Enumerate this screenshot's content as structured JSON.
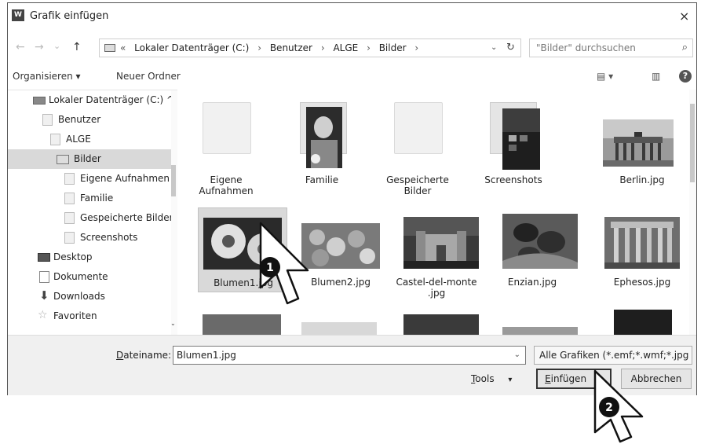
{
  "window": {
    "title": "Grafik einfügen",
    "app_icon": "W",
    "close_glyph": "×"
  },
  "nav": {
    "back_glyph": "←",
    "forward_glyph": "→",
    "recent_glyph": "⌄",
    "up_glyph": "↑",
    "breadcrumb": [
      "«",
      "Lokaler Datenträger (C:)",
      "›",
      "Benutzer",
      "›",
      "ALGE",
      "›",
      "Bilder",
      "›"
    ],
    "dropdown_glyph": "⌄",
    "refresh_glyph": "↻",
    "search_placeholder": "\"Bilder\" durchsuchen",
    "search_glyph": "⌕"
  },
  "toolbar": {
    "organize": "Organisieren ▾",
    "new_folder": "Neuer Ordner",
    "view_glyph": "▤ ▾",
    "pane_glyph": "▥",
    "help_glyph": "?"
  },
  "sidebar": {
    "items": [
      {
        "label": "Lokaler Datenträger (C:)",
        "icon": "drive-icon",
        "expand": "^"
      },
      {
        "label": "Benutzer",
        "icon": "folder-icon"
      },
      {
        "label": "ALGE",
        "icon": "folder-icon"
      },
      {
        "label": "Bilder",
        "icon": "pictures-icon"
      },
      {
        "label": "Eigene Aufnahmen",
        "icon": "folder-icon"
      },
      {
        "label": "Familie",
        "icon": "folder-icon"
      },
      {
        "label": "Gespeicherte Bilder",
        "icon": "folder-icon"
      },
      {
        "label": "Screenshots",
        "icon": "folder-icon"
      },
      {
        "label": "Desktop",
        "icon": "desktop-icon"
      },
      {
        "label": "Dokumente",
        "icon": "document-icon"
      },
      {
        "label": "Downloads",
        "icon": "download-icon",
        "glyph": "⬇"
      },
      {
        "label": "Favoriten",
        "icon": "star-icon",
        "glyph": "☆",
        "expand": "⌄"
      }
    ]
  },
  "files": [
    {
      "label": "Eigene Aufnahmen",
      "kind": "folder"
    },
    {
      "label": "Familie",
      "kind": "folder-photo"
    },
    {
      "label": "Gespeicherte Bilder",
      "kind": "folder"
    },
    {
      "label": "Screenshots",
      "kind": "folder-photo"
    },
    {
      "label": "Berlin.jpg",
      "kind": "photo"
    },
    {
      "label": "Blumen1.jpg",
      "kind": "photo"
    },
    {
      "label": "Blumen2.jpg",
      "kind": "photo"
    },
    {
      "label": "Castel-del-monte .jpg",
      "kind": "photo"
    },
    {
      "label": "Enzian.jpg",
      "kind": "photo"
    },
    {
      "label": "Ephesos.jpg",
      "kind": "photo"
    }
  ],
  "bottom": {
    "filename_label_underlined": "D",
    "filename_label_rest": "ateiname:",
    "filename_value": "Blumen1.jpg",
    "filetype_value": "Alle Grafiken (*.emf;*.wmf;*.jpg",
    "caret_glyph": "⌄",
    "tools_underlined": "T",
    "tools_rest": "ools",
    "tools_caret": "▾",
    "insert_underlined": "E",
    "insert_rest": "infügen",
    "insert_caret": "▾",
    "cancel_label": "Abbrechen"
  },
  "annotations": {
    "step1": "1",
    "step2": "2"
  },
  "colors": {
    "selection": "#d9d9d9",
    "border": "#adadad",
    "text": "#222222"
  }
}
